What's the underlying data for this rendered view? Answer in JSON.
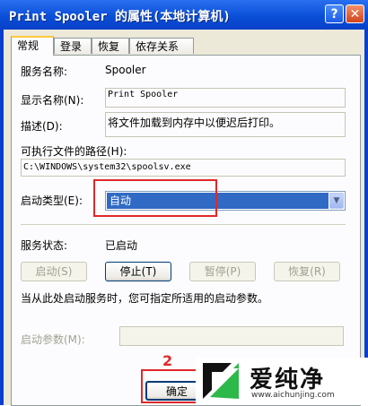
{
  "window": {
    "title": "Print Spooler 的属性(本地计算机)",
    "help_glyph": "?",
    "close_glyph": "✕"
  },
  "tabs": [
    {
      "label": "常规"
    },
    {
      "label": "登录"
    },
    {
      "label": "恢复"
    },
    {
      "label": "依存关系"
    }
  ],
  "general": {
    "service_name_label": "服务名称:",
    "service_name_value": "Spooler",
    "display_name_label": "显示名称(N):",
    "display_name_value": "Print Spooler",
    "description_label": "描述(D):",
    "description_value": "将文件加载到内存中以便迟后打印。",
    "exe_path_label": "可执行文件的路径(H):",
    "exe_path_value": "C:\\WINDOWS\\system32\\spoolsv.exe",
    "startup_type_label": "启动类型(E):",
    "startup_type_value": "自动",
    "status_label": "服务状态:",
    "status_value": "已启动",
    "buttons": {
      "start": "启动(S)",
      "stop": "停止(T)",
      "pause": "暂停(P)",
      "resume": "恢复(R)"
    },
    "hint": "当从此处启动服务时，您可指定所适用的启动参数。",
    "start_params_label": "启动参数(M):",
    "start_params_value": ""
  },
  "footer": {
    "ok_label": "确定"
  },
  "annotation": {
    "step_number": "2",
    "color": "#e0282a"
  },
  "watermark": {
    "brand": "爱纯净",
    "url": "www.aichunjing.com"
  }
}
